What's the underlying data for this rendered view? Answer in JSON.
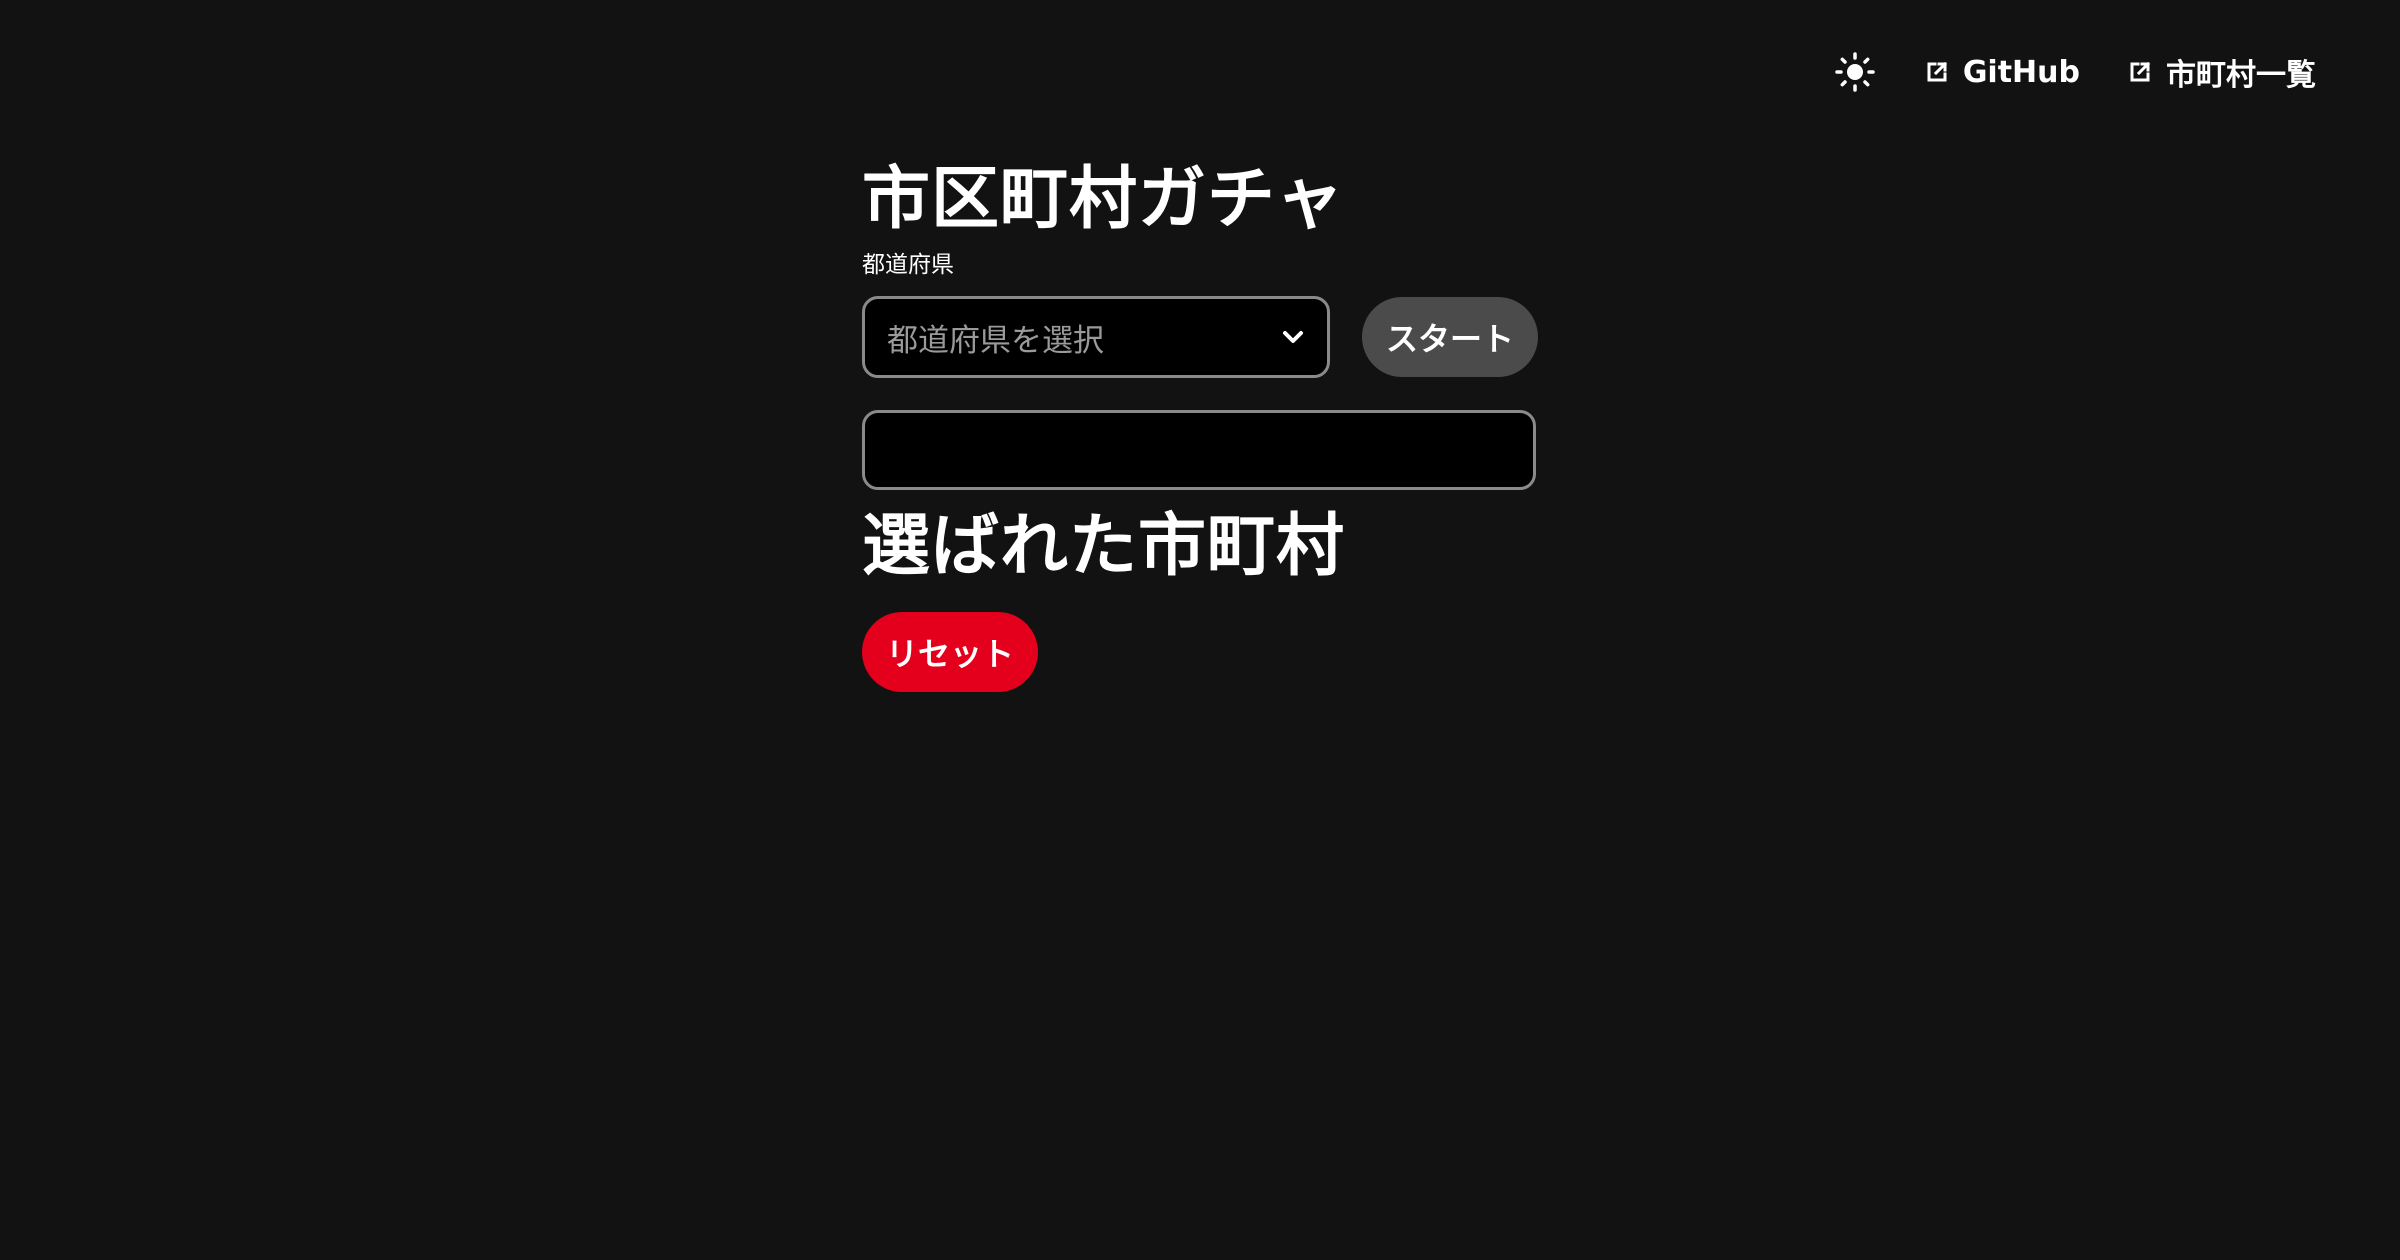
{
  "nav": {
    "theme_toggle_icon": "sun-icon",
    "links": [
      {
        "label": "GitHub",
        "icon": "external-link-icon"
      },
      {
        "label": "市町村一覧",
        "icon": "external-link-icon"
      }
    ]
  },
  "page": {
    "title": "市区町村ガチャ",
    "prefecture_label": "都道府県",
    "prefecture_select": {
      "placeholder": "都道府県を選択",
      "icon": "chevron-down-icon"
    },
    "start_button": "スタート",
    "result_value": "",
    "chosen_heading": "選ばれた市町村",
    "reset_button": "リセット"
  },
  "colors": {
    "background": "#121212",
    "start_button": "#4b4b4b",
    "reset_button": "#e4001c",
    "input_border": "#8a8a8a",
    "input_background": "#000000"
  }
}
